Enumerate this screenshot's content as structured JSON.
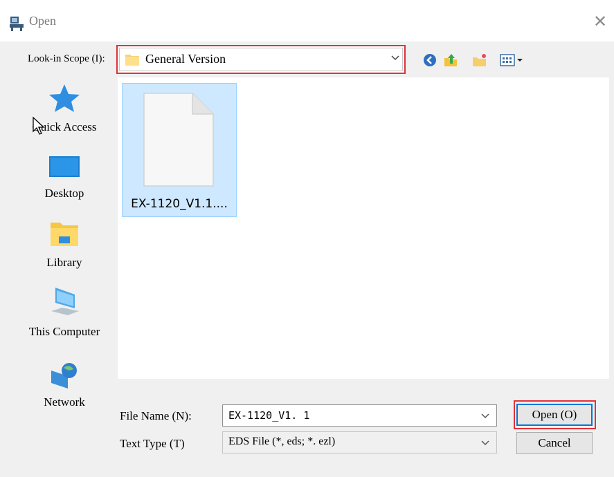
{
  "window": {
    "title": "Open",
    "close_label": "✕"
  },
  "lookin": {
    "label": "Look-in Scope (I):",
    "value": "General Version"
  },
  "toolbar": {
    "icons": [
      "back-icon",
      "up-folder-icon",
      "new-folder-icon",
      "view-menu-icon"
    ]
  },
  "sidebar": {
    "items": [
      {
        "label": "Quick Access",
        "icon": "star-icon"
      },
      {
        "label": "Desktop",
        "icon": "desktop-icon"
      },
      {
        "label": "Library",
        "icon": "library-folder-icon"
      },
      {
        "label": "This Computer",
        "icon": "computer-icon"
      },
      {
        "label": "Network",
        "icon": "network-globe-icon"
      }
    ]
  },
  "files": [
    {
      "name": "EX-1120_V1.1...."
    }
  ],
  "form": {
    "filename_label": "File Name (N):",
    "filename_value": "EX-1120_V1. 1",
    "filetype_label": "Text Type (T)",
    "filetype_value": "EDS File (*, eds; *. ezl)"
  },
  "buttons": {
    "open": "Open (O)",
    "cancel": "Cancel"
  },
  "colors": {
    "highlight_border": "#e03238",
    "selection_fill": "#cde8ff",
    "accent": "#0078d7"
  }
}
